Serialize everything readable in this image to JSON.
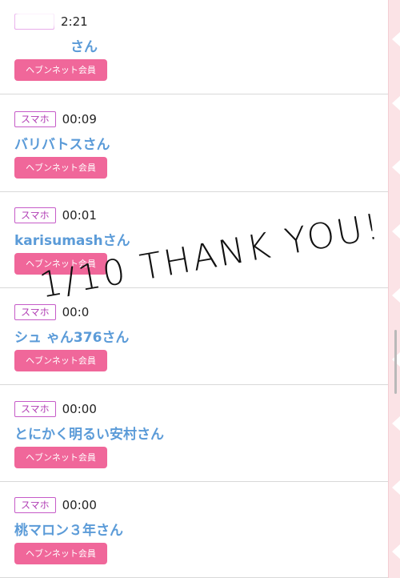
{
  "items": [
    {
      "tag": "",
      "time": "2:21",
      "name": "さん",
      "member_label": "ヘブンネット会員"
    },
    {
      "tag": "スマホ",
      "time": "00:09",
      "name": "バリバトスさん",
      "member_label": "ヘブンネット会員"
    },
    {
      "tag": "スマホ",
      "time": "00:01",
      "name": "karisumashさん",
      "member_label": "ヘブンネット会員"
    },
    {
      "tag": "スマホ",
      "time": "00:0",
      "name": "シュ ゃん376さん",
      "member_label": "ヘブンネット会員"
    },
    {
      "tag": "スマホ",
      "time": "00:00",
      "name": "とにかく明るい安村さん",
      "member_label": "ヘブンネット会員"
    },
    {
      "tag": "スマホ",
      "time": "00:00",
      "name": "桃マロン３年さん",
      "member_label": "ヘブンネット会員"
    }
  ],
  "overlay_text": "1/10 THANK YOU!",
  "colors": {
    "accent_pink": "#f0679a",
    "tag_border": "#c65bc8",
    "name_blue": "#5b9bd8",
    "strip": "#fbe3e6"
  }
}
